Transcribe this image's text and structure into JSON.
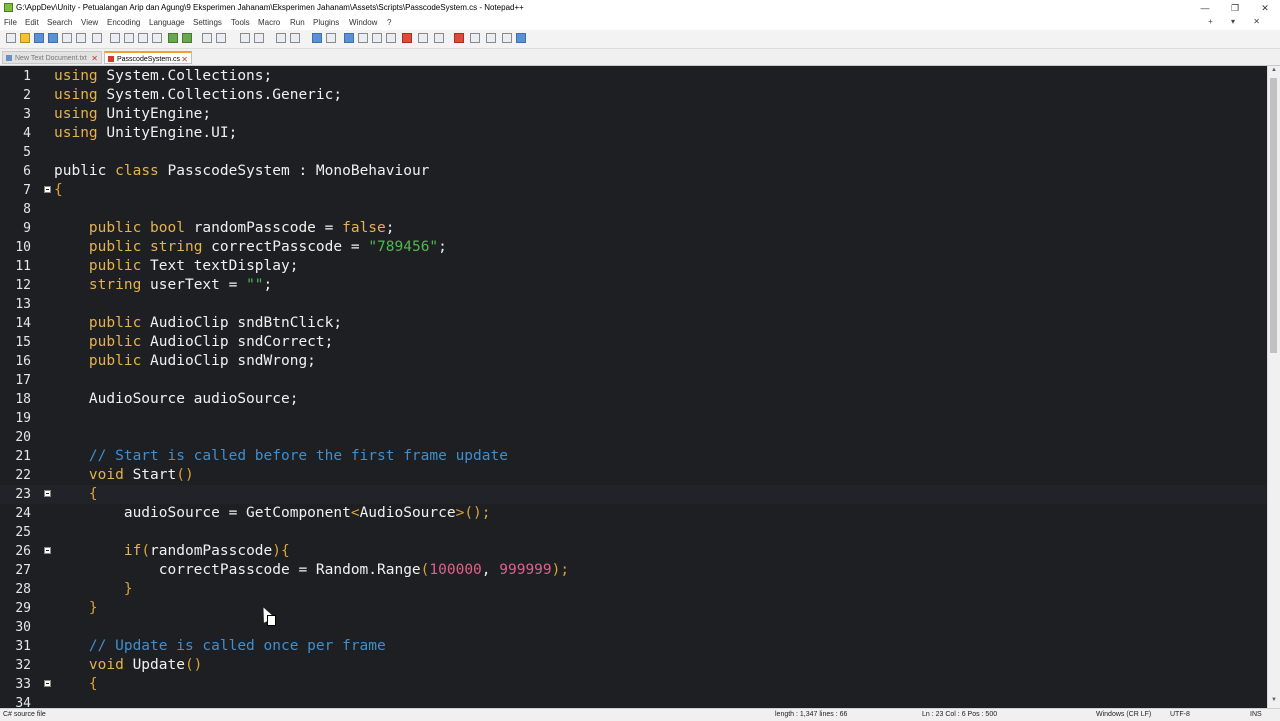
{
  "window": {
    "title": "G:\\AppDev\\Unity - Petualangan Arip dan Agung\\9 Eksperimen Jahanam\\Eksperimen Jahanam\\Assets\\Scripts\\PasscodeSystem.cs - Notepad++",
    "controls": [
      "—",
      "❐",
      "✕"
    ]
  },
  "menu": {
    "items": [
      "File",
      "Edit",
      "Search",
      "View",
      "Encoding",
      "Language",
      "Settings",
      "Tools",
      "Macro",
      "Run",
      "Plugins",
      "Window",
      "?"
    ],
    "right": "+ ▾ ✕"
  },
  "tabs": [
    {
      "label": "New Text Document.txt",
      "close": "✕"
    },
    {
      "label": "PasscodeSystem.cs",
      "close": "✕"
    }
  ],
  "lines": [
    {
      "n": "1"
    },
    {
      "n": "2"
    },
    {
      "n": "3"
    },
    {
      "n": "4"
    },
    {
      "n": "5"
    },
    {
      "n": "6"
    },
    {
      "n": "7"
    },
    {
      "n": "8"
    },
    {
      "n": "9"
    },
    {
      "n": "10"
    },
    {
      "n": "11"
    },
    {
      "n": "12"
    },
    {
      "n": "13"
    },
    {
      "n": "14"
    },
    {
      "n": "15"
    },
    {
      "n": "16"
    },
    {
      "n": "17"
    },
    {
      "n": "18"
    },
    {
      "n": "19"
    },
    {
      "n": "20"
    },
    {
      "n": "21"
    },
    {
      "n": "22"
    },
    {
      "n": "23"
    },
    {
      "n": "24"
    },
    {
      "n": "25"
    },
    {
      "n": "26"
    },
    {
      "n": "27"
    },
    {
      "n": "28"
    },
    {
      "n": "29"
    },
    {
      "n": "30"
    },
    {
      "n": "31"
    },
    {
      "n": "32"
    },
    {
      "n": "33"
    },
    {
      "n": "34"
    }
  ],
  "code": {
    "l1": {
      "kw": "using",
      "rest": " System.Collections;"
    },
    "l2": {
      "kw": "using",
      "rest": " System.Collections.Generic;"
    },
    "l3": {
      "kw": "using",
      "rest": " UnityEngine;"
    },
    "l4": {
      "kw": "using",
      "rest": " UnityEngine.UI;"
    },
    "l6": {
      "kw1": "public",
      "kw2": "class",
      "rest": " PasscodeSystem : MonoBehaviour"
    },
    "l7": {
      "brace": "{"
    },
    "l9": {
      "kw1": "public",
      "kw2": "bool",
      "name": " randomPasscode = ",
      "kw3": "false",
      "end": ";"
    },
    "l10": {
      "kw1": "public",
      "kw2": "string",
      "name": " correctPasscode = ",
      "str": "\"789456\"",
      "end": ";"
    },
    "l11": {
      "kw1": "public",
      "rest": " Text textDisplay;"
    },
    "l12": {
      "kw1": "string",
      "name": " userText = ",
      "str": "\"\"",
      "end": ";"
    },
    "l14": {
      "kw1": "public",
      "rest": " AudioClip sndBtnClick;"
    },
    "l15": {
      "kw1": "public",
      "rest": " AudioClip sndCorrect;"
    },
    "l16": {
      "kw1": "public",
      "rest": " AudioClip sndWrong;"
    },
    "l18": {
      "rest": "AudioSource audioSource;"
    },
    "l21": {
      "comment": "// Start is called before the first frame update"
    },
    "l22": {
      "kw1": "void",
      "name": " Start",
      "paren": "()"
    },
    "l23": {
      "brace": "{"
    },
    "l24": {
      "name": "audioSource = GetComponent",
      "lt": "<",
      "type": "AudioSource",
      "gt": ">",
      "paren": "();"
    },
    "l26": {
      "kw1": "if",
      "paren1": "(",
      "name": "randomPasscode",
      "paren2": "){"
    },
    "l27": {
      "name": "correctPasscode = Random.Range",
      "paren1": "(",
      "num1": "100000",
      "comma": ", ",
      "num2": "999999",
      "paren2": ");"
    },
    "l28": {
      "brace": "}"
    },
    "l29": {
      "brace": "}"
    },
    "l31": {
      "comment": "// Update is called once per frame"
    },
    "l32": {
      "kw1": "void",
      "name": " Update",
      "paren": "()"
    },
    "l33": {
      "brace": "{"
    }
  },
  "status": {
    "filetype": "C# source file",
    "length": "length : 1,347    lines : 66",
    "position": "Ln : 23    Col : 6    Pos : 500",
    "eol": "Windows (CR LF)",
    "encoding": "UTF-8",
    "mode": "INS"
  }
}
